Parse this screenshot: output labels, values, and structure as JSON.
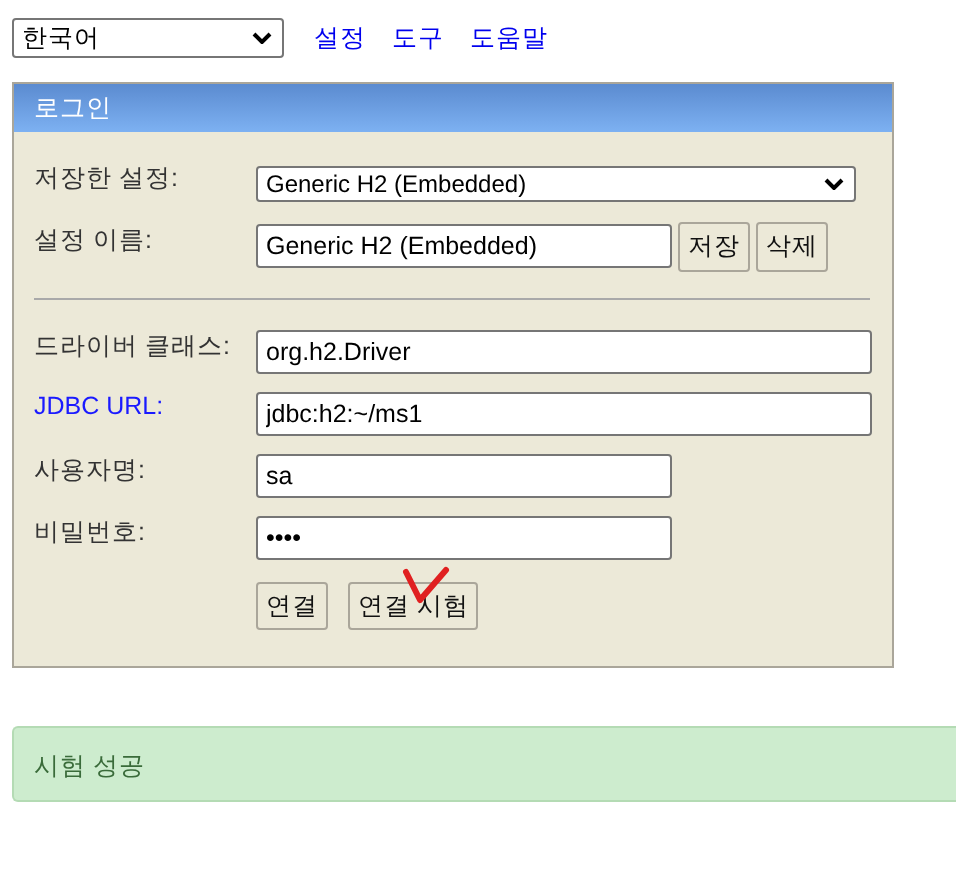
{
  "top_bar": {
    "language": "한국어",
    "links": [
      "설정",
      "도구",
      "도움말"
    ]
  },
  "login_panel": {
    "title": "로그인",
    "saved_settings": {
      "label": "저장한 설정:",
      "value": "Generic H2 (Embedded)"
    },
    "setting_name": {
      "label": "설정 이름:",
      "value": "Generic H2 (Embedded)",
      "buttons": [
        "저장",
        "삭제"
      ]
    },
    "fields": [
      {
        "label": "드라이버 클래스:",
        "value": "org.h2.Driver",
        "link": false
      },
      {
        "label": "JDBC URL:",
        "value": "jdbc:h2:~/ms1",
        "link": true
      },
      {
        "label": "사용자명:",
        "value": "sa",
        "link": false
      },
      {
        "label": "비밀번호:",
        "value": "••••",
        "link": false
      }
    ],
    "buttons": [
      "연결",
      "연결 시험"
    ]
  },
  "status": {
    "message": "시험 성공"
  }
}
